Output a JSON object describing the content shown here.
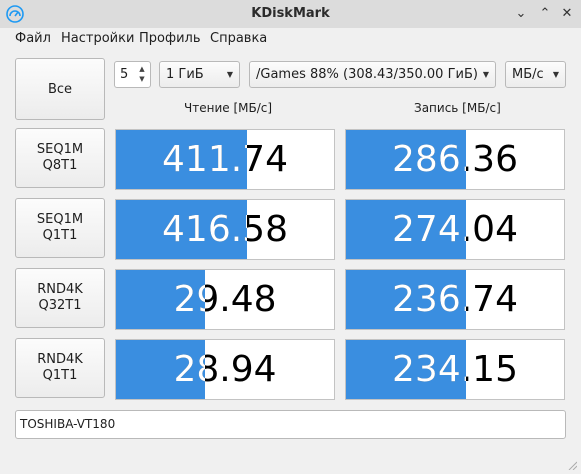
{
  "window": {
    "title": "KDiskMark",
    "minimize_glyph": "⌄",
    "maximize_glyph": "⌃",
    "close_glyph": "✕"
  },
  "menu": [
    "Файл",
    "Настройки",
    "Профиль",
    "Справка"
  ],
  "toolbar": {
    "all_label": "Все",
    "runs_value": "5",
    "size_value": "1 ГиБ",
    "target_value": "/Games 88% (308.43/350.00 ГиБ)",
    "units_value": "МБ/с"
  },
  "headers": {
    "read": "Чтение [МБ/с]",
    "write": "Запись [МБ/с]"
  },
  "tests": [
    {
      "label_line1": "SEQ1M",
      "label_line2": "Q8T1",
      "read": "411.74",
      "write": "286.36",
      "read_fill": 0.6,
      "write_fill": 0.55
    },
    {
      "label_line1": "SEQ1M",
      "label_line2": "Q1T1",
      "read": "416.58",
      "write": "274.04",
      "read_fill": 0.6,
      "write_fill": 0.55
    },
    {
      "label_line1": "RND4K",
      "label_line2": "Q32T1",
      "read": "29.48",
      "write": "236.74",
      "read_fill": 0.41,
      "write_fill": 0.55
    },
    {
      "label_line1": "RND4K",
      "label_line2": "Q1T1",
      "read": "28.94",
      "write": "234.15",
      "read_fill": 0.41,
      "write_fill": 0.55
    }
  ],
  "device_name": "TOSHIBA-VT180",
  "colors": {
    "bar": "#3a8ee0",
    "titlebar": "#dcdcdc"
  }
}
